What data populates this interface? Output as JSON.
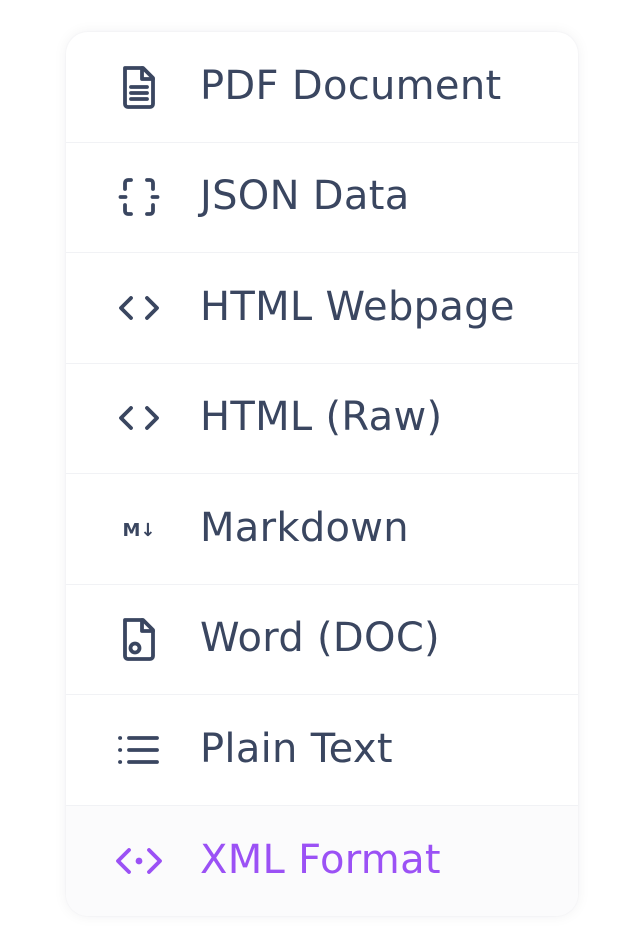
{
  "menu": {
    "items": [
      {
        "label": "PDF Document",
        "icon": "file-text-icon"
      },
      {
        "label": "JSON Data",
        "icon": "braces-icon"
      },
      {
        "label": "HTML Webpage",
        "icon": "code-icon"
      },
      {
        "label": "HTML (Raw)",
        "icon": "code-icon"
      },
      {
        "label": "Markdown",
        "icon": "markdown-icon",
        "icon_text": "M↓"
      },
      {
        "label": "Word (DOC)",
        "icon": "file-doc-icon"
      },
      {
        "label": "Plain Text",
        "icon": "list-icon"
      },
      {
        "label": "XML Format",
        "icon": "code-xml-icon",
        "active": true
      }
    ]
  },
  "colors": {
    "text": "#3a4660",
    "active": "#9b51f5",
    "divider": "#f1f2f5"
  }
}
